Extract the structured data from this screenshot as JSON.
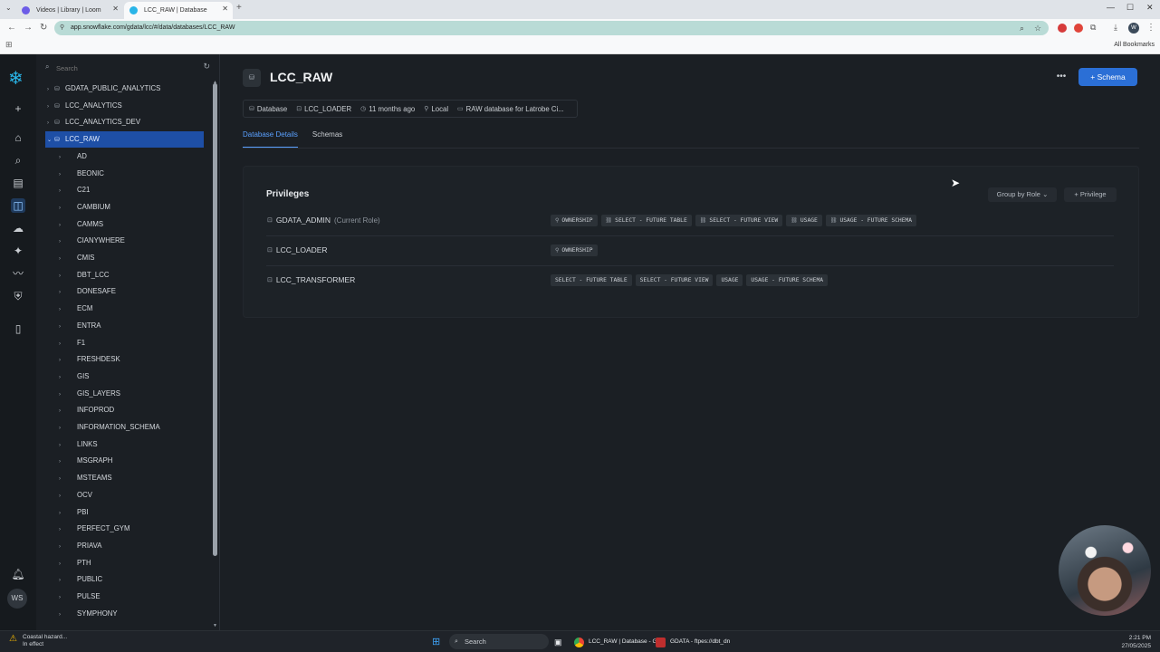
{
  "browser": {
    "tabs": [
      {
        "title": "Videos | Library | Loom",
        "active": false
      },
      {
        "title": "LCC_RAW | Database",
        "active": true
      }
    ],
    "url": "app.snowflake.com/gdata/lcc/#/data/databases/LCC_RAW",
    "bookmarks_label": "All Bookmarks",
    "profile_initial": "W"
  },
  "rail": {
    "items": [
      "add-icon",
      "home-icon",
      "search-icon",
      "worksheets-icon",
      "data-icon",
      "cloud-icon",
      "ai-icon",
      "monitoring-icon",
      "admin-icon",
      "sidebar-toggle-icon"
    ],
    "notification_icon": "bell-icon",
    "avatar_initials": "WS"
  },
  "explorer": {
    "search_placeholder": "Search",
    "databases": [
      {
        "name": "GDATA_PUBLIC_ANALYTICS",
        "expanded": false
      },
      {
        "name": "LCC_ANALYTICS",
        "expanded": false
      },
      {
        "name": "LCC_ANALYTICS_DEV",
        "expanded": false
      },
      {
        "name": "LCC_RAW",
        "expanded": true,
        "selected": true
      }
    ],
    "schemas": [
      "AD",
      "BEONIC",
      "C21",
      "CAMBIUM",
      "CAMMS",
      "CIANYWHERE",
      "CMIS",
      "DBT_LCC",
      "DONESAFE",
      "ECM",
      "ENTRA",
      "F1",
      "FRESHDESK",
      "GIS",
      "GIS_LAYERS",
      "INFOPROD",
      "INFORMATION_SCHEMA",
      "LINKS",
      "MSGRAPH",
      "MSTEAMS",
      "OCV",
      "PBI",
      "PERFECT_GYM",
      "PRIAVA",
      "PTH",
      "PUBLIC",
      "PULSE",
      "SYMPHONY"
    ]
  },
  "main": {
    "title": "LCC_RAW",
    "schema_button": "Schema",
    "meta": {
      "type": "Database",
      "owner": "LCC_LOADER",
      "created": "11 months ago",
      "location": "Local",
      "comment": "RAW database for Latrobe Ci..."
    },
    "tabs": [
      "Database Details",
      "Schemas"
    ],
    "privileges": {
      "title": "Privileges",
      "group_by": "Group by Role",
      "add_button": "Privilege",
      "roles": [
        {
          "name": "GDATA_ADMIN",
          "note": "(Current Role)",
          "privileges": [
            "OWNERSHIP",
            "SELECT - FUTURE TABLE",
            "SELECT - FUTURE VIEW",
            "USAGE",
            "USAGE - FUTURE SCHEMA"
          ]
        },
        {
          "name": "LCC_LOADER",
          "note": "",
          "privileges": [
            "OWNERSHIP"
          ]
        },
        {
          "name": "LCC_TRANSFORMER",
          "note": "",
          "privileges": [
            "SELECT - FUTURE TABLE",
            "SELECT - FUTURE VIEW",
            "USAGE",
            "USAGE - FUTURE SCHEMA"
          ]
        }
      ]
    }
  },
  "taskbar": {
    "weather_line1": "Coastal hazard...",
    "weather_line2": "In effect",
    "search_label": "Search",
    "apps": [
      "LCC_RAW | Database - G",
      "GDATA - ftpes://dbt_dn"
    ],
    "time": "2:21 PM",
    "date": "27/05/2025"
  }
}
